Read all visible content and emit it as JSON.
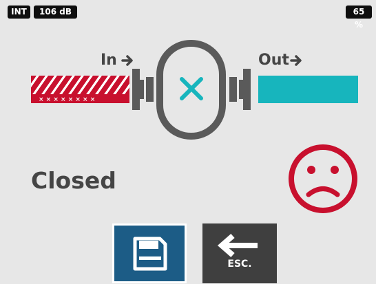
{
  "status_bar": {
    "input_mode": "INT",
    "sound_level": "106 dB",
    "battery": "65 %"
  },
  "valve": {
    "in_label": "In",
    "out_label": "Out",
    "state": "Closed",
    "state_icon": "x-mark-icon",
    "mood_icon": "sad-face-icon"
  },
  "buttons": {
    "save_icon": "floppy-disk-icon",
    "esc_label": "ESC."
  },
  "colors": {
    "inlet_pipe": "#c8102e",
    "outlet_pipe": "#17b5bd",
    "valve_body": "#5a5a5a",
    "status_bad": "#c8102e",
    "save_button": "#1c5c86",
    "esc_button": "#3f3f3f",
    "background": "#e7e7e7"
  }
}
